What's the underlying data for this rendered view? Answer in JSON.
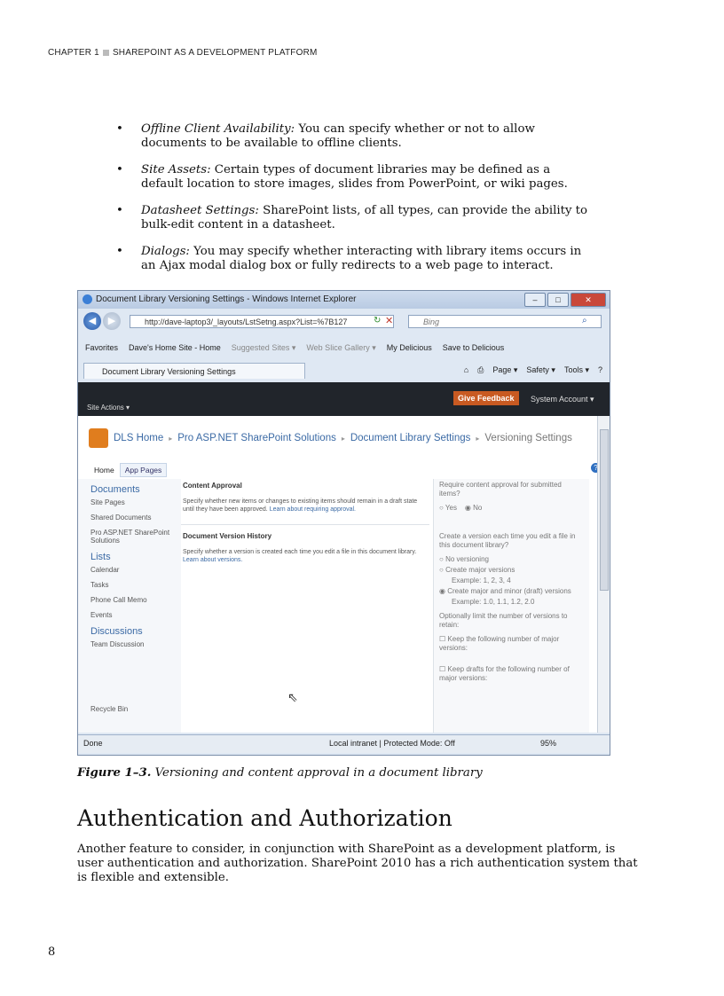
{
  "header": {
    "chapter": "CHAPTER 1",
    "section": "SHAREPOINT AS A DEVELOPMENT PLATFORM"
  },
  "bullets": [
    {
      "term": "Offline Client Availability:",
      "text": " You can specify whether or not to allow documents to be available to offline clients."
    },
    {
      "term": "Site Assets:",
      "text": " Certain types of document libraries may be defined as a default location to store images, slides from PowerPoint, or wiki pages."
    },
    {
      "term": "Datasheet Settings:",
      "text": " SharePoint lists, of all types, can provide the ability to bulk-edit content in a datasheet."
    },
    {
      "term": "Dialogs:",
      "text": " You may specify whether interacting with library items occurs in an Ajax modal dialog box or fully redirects to a web page to interact."
    }
  ],
  "screenshot": {
    "window_title": "Document Library Versioning Settings - Windows Internet Explorer",
    "url": "http://dave-laptop3/_layouts/LstSetng.aspx?List=%7B127",
    "search_placeholder": "Bing",
    "favorites": [
      "Favorites",
      "Dave's Home Site - Home",
      "Suggested Sites ▾",
      "Web Slice Gallery ▾",
      "My Delicious",
      "Save to Delicious"
    ],
    "tab_title": "Document Library Versioning Settings",
    "commands": [
      "Page ▾",
      "Safety ▾",
      "Tools ▾"
    ],
    "site_actions": "Site Actions ▾",
    "give_feedback": "Give Feedback",
    "account": "System Account ▾",
    "breadcrumb": [
      "DLS Home",
      "Pro ASP.NET SharePoint Solutions",
      "Document Library Settings",
      "Versioning Settings"
    ],
    "page_tabs": [
      "Home",
      "App Pages"
    ],
    "quick_launch": {
      "documents": "Documents",
      "doc_items": [
        "Site Pages",
        "Shared Documents",
        "Pro ASP.NET SharePoint Solutions"
      ],
      "lists": "Lists",
      "list_items": [
        "Calendar",
        "Tasks",
        "Phone Call Memo",
        "Events"
      ],
      "discussions": "Discussions",
      "discussion_items": [
        "Team Discussion"
      ],
      "recycle": "Recycle Bin"
    },
    "content_approval": {
      "heading": "Content Approval",
      "desc": "Specify whether new items or changes to existing items should remain in a draft state until they have been approved.",
      "link": "Learn about requiring approval.",
      "question": "Require content approval for submitted items?",
      "options": [
        "Yes",
        "No"
      ]
    },
    "version_history": {
      "heading": "Document Version History",
      "desc": "Specify whether a version is created each time you edit a file in this document library.",
      "link": "Learn about versions.",
      "question": "Create a version each time you edit a file in this document library?",
      "options": [
        "No versioning",
        "Create major versions",
        "Example: 1, 2, 3, 4",
        "Create major and minor (draft) versions",
        "Example: 1.0, 1.1, 1.2, 2.0"
      ],
      "limit": "Optionally limit the number of versions to retain:",
      "keep_major": "Keep the following number of major versions:",
      "keep_drafts": "Keep drafts for the following number of major versions:"
    },
    "status": {
      "left": "Done",
      "zone": "Local intranet | Protected Mode: Off",
      "zoom": "95%"
    }
  },
  "caption": {
    "label": "Figure 1–3.",
    "text": " Versioning and content approval in a document library"
  },
  "section_heading": "Authentication and Authorization",
  "paragraph": "Another feature to consider, in conjunction with SharePoint as a development platform, is user authentication and authorization. SharePoint 2010 has a rich authentication system that is flexible and extensible.",
  "page_number": "8"
}
